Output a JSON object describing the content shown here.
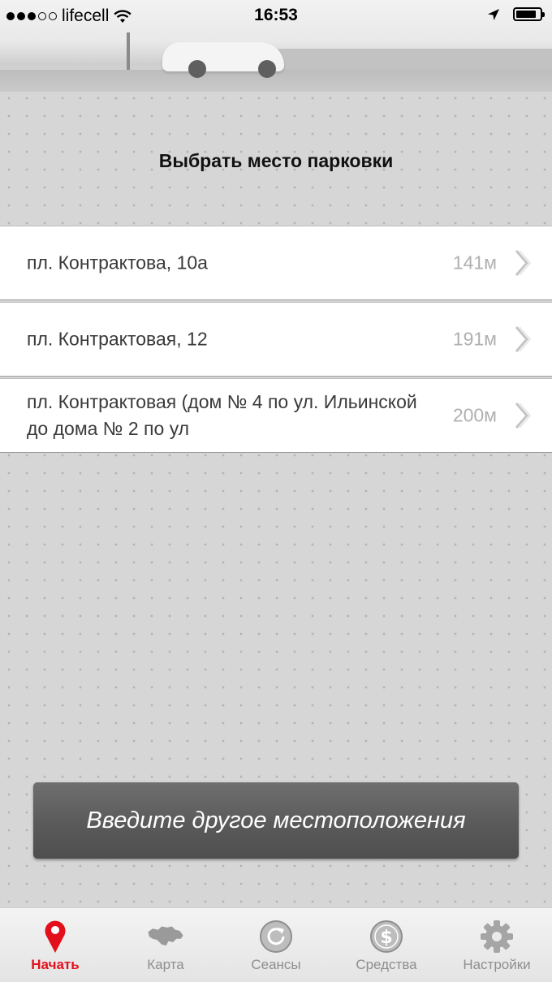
{
  "status_bar": {
    "carrier": "lifecell",
    "time": "16:53",
    "signal_bars_filled": 3,
    "signal_bars_total": 5,
    "battery_level": 0.85
  },
  "header": {
    "title": "Выбрать место парковки"
  },
  "locations": [
    {
      "name": "пл. Контрактова, 10а",
      "distance": "141м"
    },
    {
      "name": "пл. Контрактовая, 12",
      "distance": "191м"
    },
    {
      "name": "пл. Контрактовая (дом № 4 по ул. Ильинской до дома № 2 по ул",
      "distance": "200м"
    }
  ],
  "other_location_button": {
    "label": "Введите другое местоположения"
  },
  "tab_bar": {
    "tabs": [
      {
        "label": "Начать",
        "icon": "map-pin-icon",
        "active": true
      },
      {
        "label": "Карта",
        "icon": "ukraine-map-icon",
        "active": false
      },
      {
        "label": "Сеансы",
        "icon": "refresh-icon",
        "active": false
      },
      {
        "label": "Средства",
        "icon": "dollar-coin-icon",
        "active": false
      },
      {
        "label": "Настройки",
        "icon": "gear-icon",
        "active": false
      }
    ]
  },
  "colors": {
    "accent": "#e3101b",
    "button": "#5a5a5a",
    "inactive_tab": "#8e8e8e"
  }
}
